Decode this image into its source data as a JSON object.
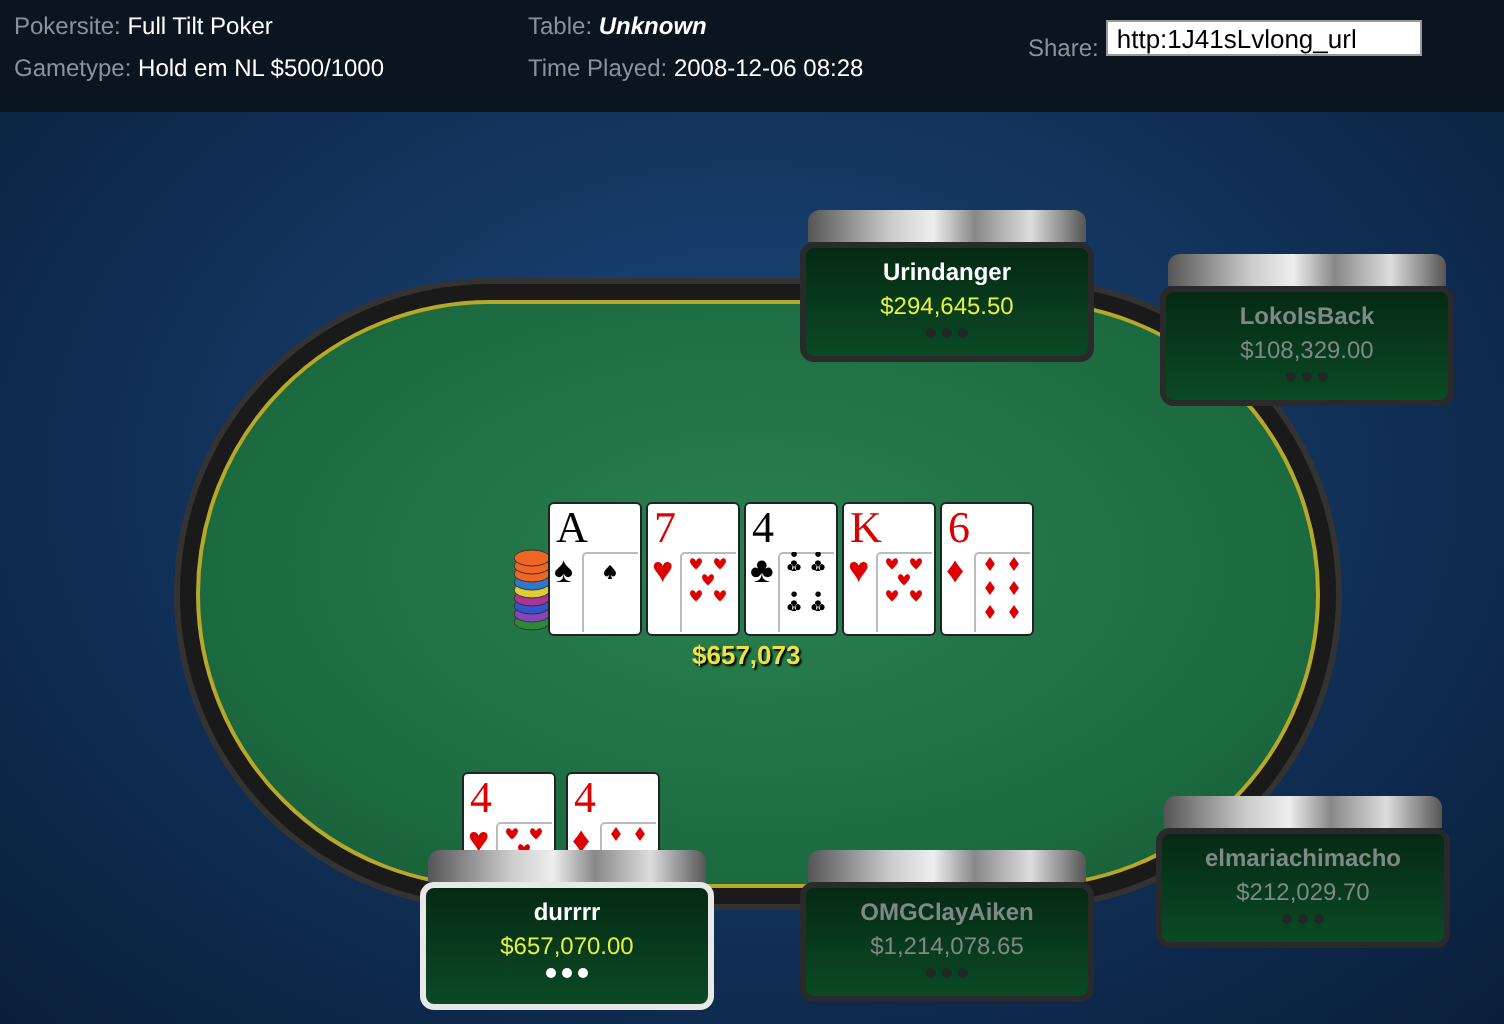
{
  "header": {
    "fields": [
      {
        "label": "Pokersite:",
        "value": "Full Tilt Poker",
        "italic": false
      },
      {
        "label": "Gametype:",
        "value": "Hold em NL $500/1000",
        "italic": false
      },
      {
        "label": "Table:",
        "value": "Unknown",
        "italic": true
      },
      {
        "label": "Time Played:",
        "value": "2008-12-06 08:28",
        "italic": false
      }
    ],
    "share": {
      "label": "Share:",
      "value": "http:1J41sLvlong_url"
    }
  },
  "board": [
    {
      "rank": "A",
      "suit": "♠",
      "kind": "spade",
      "color": "#000000"
    },
    {
      "rank": "7",
      "suit": "♥",
      "kind": "heart",
      "color": "#dd0000"
    },
    {
      "rank": "4",
      "suit": "♣",
      "kind": "club",
      "color": "#000000"
    },
    {
      "rank": "K",
      "suit": "♥",
      "kind": "heart",
      "color": "#dd0000"
    },
    {
      "rank": "6",
      "suit": "♦",
      "kind": "diamond",
      "color": "#dd0000"
    }
  ],
  "pot": "$657,073",
  "seats": [
    {
      "name": "Urindanger",
      "stack": "$294,645.50",
      "folded": false,
      "selected": false
    },
    {
      "name": "LokoIsBack",
      "stack": "$108,329.00",
      "folded": true,
      "selected": false
    },
    {
      "name": "durrrr",
      "stack": "$657,070.00",
      "folded": false,
      "selected": true,
      "cards": [
        {
          "rank": "4",
          "suit": "♥",
          "kind": "heart",
          "color": "#dd0000"
        },
        {
          "rank": "4",
          "suit": "♦",
          "kind": "diamond",
          "color": "#dd0000"
        }
      ]
    },
    {
      "name": "OMGClayAiken",
      "stack": "$1,214,078.65",
      "folded": true,
      "selected": false
    },
    {
      "name": "elmariachimacho",
      "stack": "$212,029.70",
      "folded": true,
      "selected": false
    }
  ]
}
